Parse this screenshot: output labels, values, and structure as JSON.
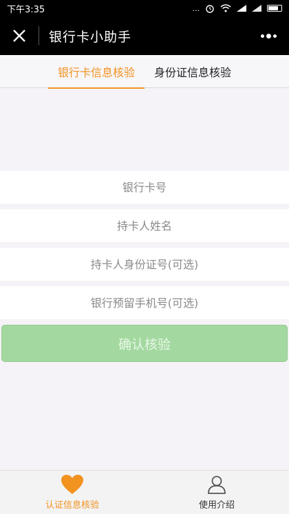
{
  "status_bar": {
    "time": "下午3:35",
    "network": "...",
    "signal_1": "signal-icon",
    "signal_2": "signal-icon",
    "battery": "battery-icon"
  },
  "header": {
    "title": "银行卡小助手",
    "close_icon": "close-icon",
    "more_icon": "more-icon"
  },
  "tabs": [
    {
      "label": "银行卡信息核验",
      "active": true
    },
    {
      "label": "身份证信息核验",
      "active": false
    }
  ],
  "form": {
    "fields": [
      {
        "placeholder": "银行卡号",
        "value": ""
      },
      {
        "placeholder": "持卡人姓名",
        "value": ""
      },
      {
        "placeholder": "持卡人身份证号(可选)",
        "value": ""
      },
      {
        "placeholder": "银行预留手机号(可选)",
        "value": ""
      }
    ],
    "submit_label": "确认核验"
  },
  "bottom_nav": [
    {
      "label": "认证信息核验",
      "icon": "heart-icon",
      "active": true
    },
    {
      "label": "使用介绍",
      "icon": "user-icon",
      "active": false
    }
  ],
  "colors": {
    "accent": "#f2921f",
    "submit_bg": "#a3d9a0"
  }
}
